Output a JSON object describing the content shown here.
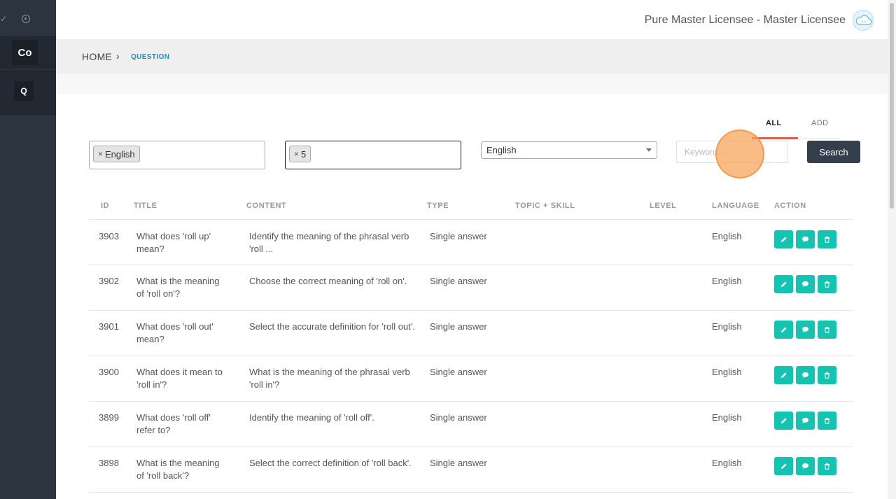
{
  "sidebar": {
    "items": [
      {
        "label": "Co"
      },
      {
        "label": "Q"
      }
    ]
  },
  "header": {
    "user_name": "Pure Master Licensee - Master Licensee"
  },
  "breadcrumb": {
    "home": "HOME",
    "separator": "›",
    "current": "QUESTION"
  },
  "tabs": {
    "all": "ALL",
    "add": "ADD"
  },
  "filters": {
    "language_tag": "English",
    "level_tag": "5",
    "tag_remove": "×",
    "language_select": "English",
    "keyword_placeholder": "Keyword...",
    "search_label": "Search"
  },
  "table": {
    "headers": {
      "id": "ID",
      "title": "TITLE",
      "content": "CONTENT",
      "type": "TYPE",
      "topic": "TOPIC + SKILL",
      "level": "LEVEL",
      "language": "LANGUAGE",
      "action": "ACTION"
    },
    "rows": [
      {
        "id": "3903",
        "title": "What does 'roll up' mean?",
        "content": "Identify the meaning of the phrasal verb 'roll ...",
        "type": "Single answer",
        "topic": "",
        "level": "",
        "language": "English"
      },
      {
        "id": "3902",
        "title": "What is the meaning of 'roll on'?",
        "content": "Choose the correct meaning of 'roll on'.",
        "type": "Single answer",
        "topic": "",
        "level": "",
        "language": "English"
      },
      {
        "id": "3901",
        "title": "What does 'roll out' mean?",
        "content": "Select the accurate definition for 'roll out'.",
        "type": "Single answer",
        "topic": "",
        "level": "",
        "language": "English"
      },
      {
        "id": "3900",
        "title": "What does it mean to 'roll in'?",
        "content": "What is the meaning of the phrasal verb 'roll in'?",
        "type": "Single answer",
        "topic": "",
        "level": "",
        "language": "English"
      },
      {
        "id": "3899",
        "title": "What does 'roll off' refer to?",
        "content": "Identify the meaning of 'roll off'.",
        "type": "Single answer",
        "topic": "",
        "level": "",
        "language": "English"
      },
      {
        "id": "3898",
        "title": "What is the meaning of 'roll back'?",
        "content": "Select the correct definition of 'roll back'.",
        "type": "Single answer",
        "topic": "",
        "level": "",
        "language": "English"
      }
    ],
    "action_icons": [
      "pencil-icon",
      "comment-icon",
      "trash-icon"
    ]
  },
  "colors": {
    "sidebar": "#2c3440",
    "accent_teal": "#15c3b1",
    "breadcrumb_blue": "#1b8fc4",
    "tab_underline": "#e05c4c",
    "search_button": "#343f4b"
  }
}
